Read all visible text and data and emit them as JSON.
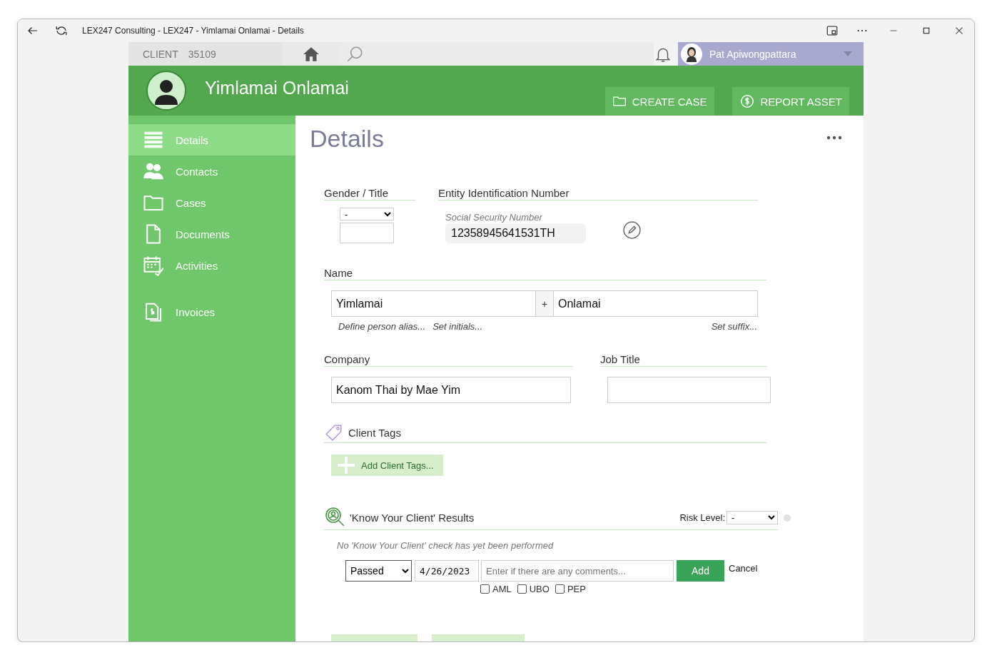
{
  "window": {
    "title": "LEX247 Consulting - LEX247 - Yimlamai Onlamai - Details"
  },
  "topbar": {
    "client_label": "CLIENT",
    "client_number": "35109",
    "user_name": "Pat Apiwongpattara"
  },
  "header": {
    "name": "Yimlamai Onlamai",
    "actions": [
      "CREATE CASE",
      "REPORT ASSET"
    ]
  },
  "sidebar": {
    "items": [
      {
        "label": "Details",
        "selected": true
      },
      {
        "label": "Contacts",
        "selected": false
      },
      {
        "label": "Cases",
        "selected": false
      },
      {
        "label": "Documents",
        "selected": false
      },
      {
        "label": "Activities",
        "selected": false
      },
      {
        "label": "Invoices",
        "selected": false
      }
    ]
  },
  "page": {
    "title": "Details"
  },
  "gender": {
    "label": "Gender / Title",
    "select_value": "-"
  },
  "entity": {
    "label": "Entity Identification Number",
    "field_label": "Social Security Number",
    "value": "12358945641531TH"
  },
  "name": {
    "label": "Name",
    "first": "Yimlamai",
    "separator": "+",
    "last": "Onlamai",
    "links": [
      "Define person alias...",
      "Set initials...",
      "Set suffix..."
    ]
  },
  "company": {
    "label": "Company",
    "value": "Kanom Thai by Mae Yim"
  },
  "job_title": {
    "label": "Job Title"
  },
  "tags": {
    "label": "Client Tags",
    "button": "Add Client Tags..."
  },
  "kyc": {
    "title": "'Know Your Client' Results",
    "risk_label": "Risk Level:",
    "risk_value": "-",
    "message": "No 'Know Your Client' check has yet been performed",
    "status": "Passed",
    "date": "4/26/2023",
    "comment_placeholder": "Enter if there are any comments...",
    "add": "Add",
    "cancel": "Cancel",
    "checks": [
      {
        "label": "AML",
        "checked": false
      },
      {
        "label": "UBO",
        "checked": false
      },
      {
        "label": "PEP",
        "checked": false
      }
    ]
  }
}
